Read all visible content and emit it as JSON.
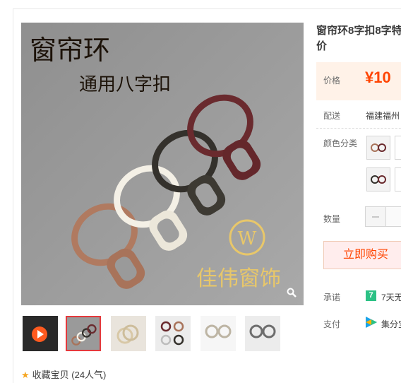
{
  "gallery": {
    "overlay_title": "窗帘环",
    "overlay_subtitle": "通用八字扣",
    "watermark": "佳伟窗饰",
    "thumbnails": [
      "video",
      "main",
      "white-rings",
      "pack",
      "white-hooks",
      "gray-hooks"
    ],
    "active_thumbnail": 1
  },
  "favorite": {
    "text": "收藏宝贝 (24人气)"
  },
  "product": {
    "title": "窗帘环8字扣8字特价",
    "price_label": "价格",
    "price": "¥10",
    "shipping_label": "配送",
    "shipping_value": "福建福州",
    "color_label": "颜色分类",
    "quantity_label": "数量",
    "buy_label": "立即购买",
    "promise_label": "承诺",
    "promise_badge": "7",
    "promise_value": "7天无",
    "pay_label": "支付",
    "pay_value": "集分宝"
  },
  "colors": {
    "accent": "#ff4400",
    "price_bg": "#fff2e8",
    "buy_bg": "#ffeded",
    "active_border": "#e4393c"
  }
}
